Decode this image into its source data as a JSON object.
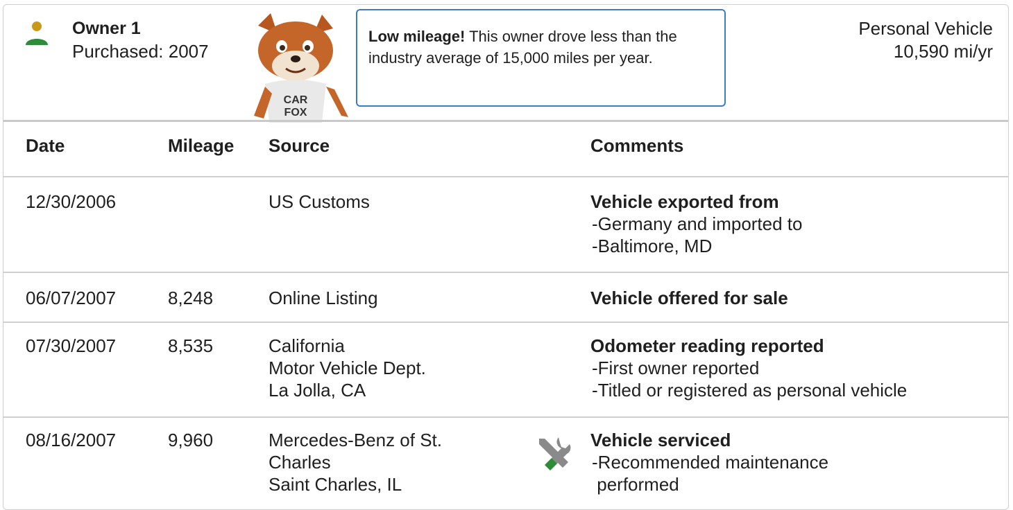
{
  "owner": {
    "title": "Owner 1",
    "purchased": "Purchased: 2007",
    "usage_type": "Personal Vehicle",
    "miles_per_year": "10,590 mi/yr"
  },
  "fox_shirt": "CAR FOX",
  "callout": {
    "bold": "Low mileage!",
    "text": " This owner drove less than the industry average of 15,000 miles per year."
  },
  "table": {
    "headers": [
      "Date",
      "Mileage",
      "Source",
      "Comments"
    ],
    "rows": [
      {
        "date": "12/30/2006",
        "mileage": "",
        "source": [
          "US Customs"
        ],
        "comment_title": "Vehicle exported from",
        "comment_items": [
          "Germany and imported to",
          "Baltimore, MD"
        ]
      },
      {
        "date": "06/07/2007",
        "mileage": "8,248",
        "source": [
          "Online Listing"
        ],
        "comment_title": "Vehicle offered for sale",
        "comment_items": []
      },
      {
        "date": "07/30/2007",
        "mileage": "8,535",
        "source": [
          "California",
          "Motor Vehicle Dept.",
          "La Jolla, CA"
        ],
        "comment_title": "Odometer reading reported",
        "comment_items": [
          "First owner reported",
          "Titled or registered as personal vehicle"
        ]
      },
      {
        "date": "08/16/2007",
        "mileage": "9,960",
        "source": [
          "Mercedes-Benz of St.",
          "Charles",
          "Saint Charles, IL"
        ],
        "comment_title": "Vehicle serviced",
        "comment_items": [
          "Recommended maintenance",
          "performed"
        ]
      }
    ]
  },
  "colors": {
    "callout_border": "#3b7cc9",
    "owner_head": "#c79a1a",
    "owner_body": "#2e8b3a",
    "wrench_green": "#2e8b3a",
    "wrench_gray": "#8a8a8a"
  },
  "icons": {
    "owner": "owner-person-icon",
    "service": "service-tools-icon"
  }
}
